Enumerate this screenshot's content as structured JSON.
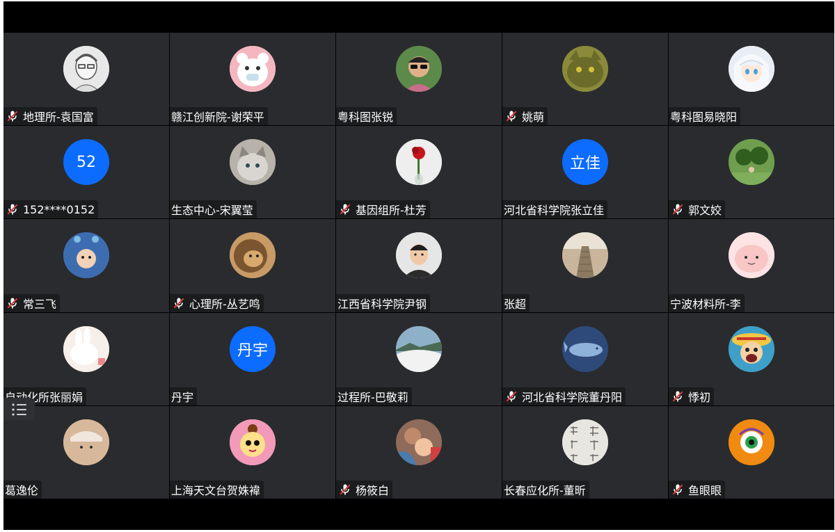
{
  "participants": [
    {
      "name": "地理所-袁国富",
      "muted": true,
      "avatar": {
        "type": "photo",
        "icon": "sketch-portrait",
        "bg": "#e8e8e8",
        "fg": "#555555"
      }
    },
    {
      "name": "赣江创新院-谢荣平",
      "muted": false,
      "avatar": {
        "type": "photo",
        "icon": "cartoon-bear",
        "bg": "#f4b7c0",
        "fg": "#ffffff"
      }
    },
    {
      "name": "粤科图张锐",
      "muted": false,
      "avatar": {
        "type": "photo",
        "icon": "man-sunglasses",
        "bg": "#5c8a4a",
        "fg": "#c96d8a"
      }
    },
    {
      "name": "姚萌",
      "muted": true,
      "avatar": {
        "type": "photo",
        "icon": "cat-face",
        "bg": "#8a8a3a",
        "fg": "#6b6b2a"
      }
    },
    {
      "name": "粤科图易晓阳",
      "muted": false,
      "avatar": {
        "type": "photo",
        "icon": "anime-girl",
        "bg": "#e9eef5",
        "fg": "#b9c9dc"
      }
    },
    {
      "name": "152****0152",
      "muted": true,
      "avatar": {
        "type": "text",
        "text": "52",
        "bg": "#0b6cff"
      }
    },
    {
      "name": "生态中心-宋翼莹",
      "muted": false,
      "avatar": {
        "type": "photo",
        "icon": "grey-cat",
        "bg": "#b7b2aa",
        "fg": "#8c8780"
      }
    },
    {
      "name": "基因组所-杜芳",
      "muted": true,
      "avatar": {
        "type": "photo",
        "icon": "red-rose",
        "bg": "#eeeeee",
        "fg": "#c4161c"
      }
    },
    {
      "name": "河北省科学院张立佳",
      "muted": false,
      "avatar": {
        "type": "text",
        "text": "立佳",
        "bg": "#0b6cff"
      }
    },
    {
      "name": "郭文姣",
      "muted": true,
      "avatar": {
        "type": "photo",
        "icon": "green-topiary",
        "bg": "#6f9e4e",
        "fg": "#2f5e1f"
      }
    },
    {
      "name": "常三飞",
      "muted": true,
      "avatar": {
        "type": "photo",
        "icon": "child-costume",
        "bg": "#3d6db0",
        "fg": "#f1d2b8"
      }
    },
    {
      "name": "心理所-丛艺鸣",
      "muted": true,
      "avatar": {
        "type": "photo",
        "icon": "lion",
        "bg": "#c79a66",
        "fg": "#7a5530"
      }
    },
    {
      "name": "江西省科学院尹钢",
      "muted": false,
      "avatar": {
        "type": "photo",
        "icon": "man-portrait",
        "bg": "#e6e6e6",
        "fg": "#2b2b2b"
      }
    },
    {
      "name": "张超",
      "muted": false,
      "avatar": {
        "type": "photo",
        "icon": "stone-steps",
        "bg": "#c9b59b",
        "fg": "#8c7a62"
      }
    },
    {
      "name": "宁波材料所-李",
      "muted": false,
      "avatar": {
        "type": "photo",
        "icon": "pink-blob",
        "bg": "#fde3e3",
        "fg": "#f4a9a9"
      }
    },
    {
      "name": "自动化所张丽娟",
      "muted": false,
      "avatar": {
        "type": "photo",
        "icon": "white-rabbit",
        "bg": "#f7efe9",
        "fg": "#e98a8a"
      }
    },
    {
      "name": "丹宇",
      "muted": false,
      "avatar": {
        "type": "text",
        "text": "丹宇",
        "bg": "#0b6cff"
      }
    },
    {
      "name": "过程所-巴敬莉",
      "muted": false,
      "avatar": {
        "type": "photo",
        "icon": "sea-of-clouds",
        "bg": "#8fb0c9",
        "fg": "#f2f2f2"
      }
    },
    {
      "name": "河北省科学院董丹阳",
      "muted": true,
      "avatar": {
        "type": "photo",
        "icon": "whale",
        "bg": "#2e4a7a",
        "fg": "#8fb2da"
      }
    },
    {
      "name": "悸初",
      "muted": true,
      "avatar": {
        "type": "photo",
        "icon": "straw-hat-cartoon",
        "bg": "#3ea0c8",
        "fg": "#f2c744"
      }
    },
    {
      "name": "葛逸伦",
      "muted": false,
      "avatar": {
        "type": "photo",
        "icon": "cat-hat",
        "bg": "#d8b89a",
        "fg": "#9c7a5a"
      }
    },
    {
      "name": "上海天文台贺姝褘",
      "muted": false,
      "avatar": {
        "type": "photo",
        "icon": "cartoon-girl",
        "bg": "#f29ab7",
        "fg": "#ffe08a"
      }
    },
    {
      "name": "杨筱白",
      "muted": true,
      "avatar": {
        "type": "photo",
        "icon": "father-baby",
        "bg": "#8e6b5a",
        "fg": "#f1c3a0"
      }
    },
    {
      "name": "长春应化所-董昕",
      "muted": false,
      "avatar": {
        "type": "photo",
        "icon": "calligraphy",
        "bg": "#e8e6e1",
        "fg": "#6a6a6a"
      }
    },
    {
      "name": "鱼眼眼",
      "muted": true,
      "avatar": {
        "type": "photo",
        "icon": "cartoon-eye",
        "bg": "#f08a10",
        "fg": "#2aa14a"
      }
    }
  ],
  "colors": {
    "tile_bg": "#2a2b2e",
    "mic_slash": "#e23b3b"
  }
}
